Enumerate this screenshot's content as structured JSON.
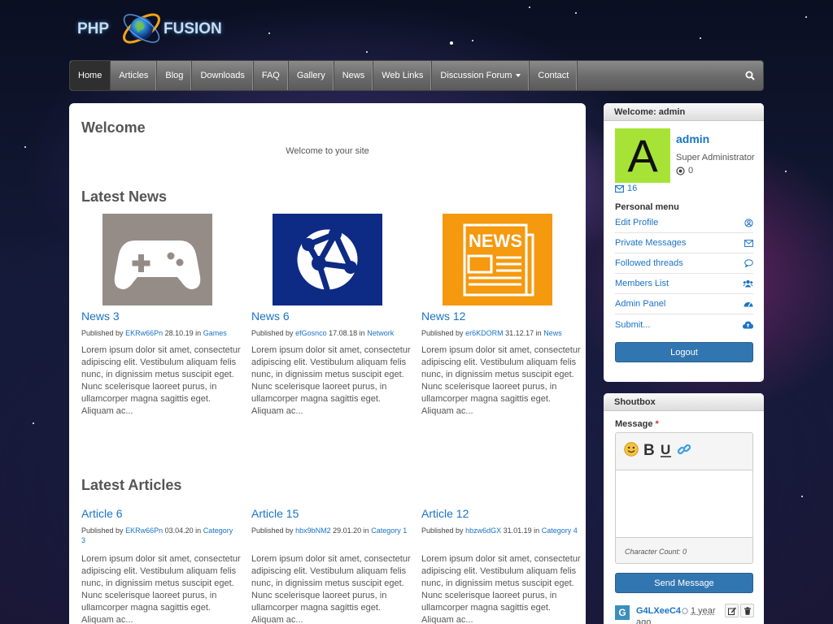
{
  "logo": {
    "left": "PHP",
    "right": "FUSION"
  },
  "nav": {
    "items": [
      {
        "label": "Home",
        "active": true
      },
      {
        "label": "Articles"
      },
      {
        "label": "Blog"
      },
      {
        "label": "Downloads"
      },
      {
        "label": "FAQ"
      },
      {
        "label": "Gallery"
      },
      {
        "label": "News"
      },
      {
        "label": "Web Links"
      },
      {
        "label": "Discussion Forum",
        "dropdown": true
      },
      {
        "label": "Contact"
      }
    ],
    "search_icon": "search-icon"
  },
  "main": {
    "welcome_title": "Welcome",
    "welcome_text": "Welcome to your site",
    "latest_news_title": "Latest News",
    "news": [
      {
        "title": "News 3",
        "published_by": "Published by",
        "author": "EKRw66Pn",
        "date": "28.10.19",
        "in": "in",
        "category": "Games",
        "icon": "gamepad-icon",
        "thumb_color": "#958c88",
        "excerpt": "Lorem ipsum dolor sit amet, consectetur adipiscing elit. Vestibulum aliquam felis nunc, in dignissim metus suscipit eget. Nunc scelerisque laoreet purus, in ullamcorper magna sagittis eget. Aliquam ac..."
      },
      {
        "title": "News 6",
        "published_by": "Published by",
        "author": "efGosnco",
        "date": "17.08.18",
        "in": "in",
        "category": "Network",
        "icon": "globe-network-icon",
        "thumb_color": "#0d2a84",
        "excerpt": "Lorem ipsum dolor sit amet, consectetur adipiscing elit. Vestibulum aliquam felis nunc, in dignissim metus suscipit eget. Nunc scelerisque laoreet purus, in ullamcorper magna sagittis eget. Aliquam ac..."
      },
      {
        "title": "News 12",
        "published_by": "Published by",
        "author": "er6KDORM",
        "date": "31.12.17",
        "in": "in",
        "category": "News",
        "icon": "newspaper-icon",
        "thumb_color": "#f5990f",
        "excerpt": "Lorem ipsum dolor sit amet, consectetur adipiscing elit. Vestibulum aliquam felis nunc, in dignissim metus suscipit eget. Nunc scelerisque laoreet purus, in ullamcorper magna sagittis eget. Aliquam ac..."
      }
    ],
    "newspaper_word": "NEWS",
    "latest_articles_title": "Latest Articles",
    "articles": [
      {
        "title": "Article 6",
        "published_by": "Published by",
        "author": "EKRw66Pn",
        "date": "03.04.20",
        "in": "in",
        "category": "Category 3",
        "excerpt": "Lorem ipsum dolor sit amet, consectetur adipiscing elit. Vestibulum aliquam felis nunc, in dignissim metus suscipit eget. Nunc scelerisque laoreet purus, in ullamcorper magna sagittis eget. Aliquam ac..."
      },
      {
        "title": "Article 15",
        "published_by": "Published by",
        "author": "hbx9bNM2",
        "date": "29.01.20",
        "in": "in",
        "category": "Category 1",
        "excerpt": "Lorem ipsum dolor sit amet, consectetur adipiscing elit. Vestibulum aliquam felis nunc, in dignissim metus suscipit eget. Nunc scelerisque laoreet purus, in ullamcorper magna sagittis eget. Aliquam ac..."
      },
      {
        "title": "Article 12",
        "published_by": "Published by",
        "author": "hbzw6dGX",
        "date": "31.01.19",
        "in": "in",
        "category": "Category 4",
        "excerpt": "Lorem ipsum dolor sit amet, consectetur adipiscing elit. Vestibulum aliquam felis nunc, in dignissim metus suscipit eget. Nunc scelerisque laoreet purus, in ullamcorper magna sagittis eget. Aliquam ac..."
      }
    ]
  },
  "user_panel": {
    "heading": "Welcome: admin",
    "avatar_letter": "A",
    "avatar_color": "#a6e336",
    "username": "admin",
    "role": "Super Administrator",
    "points": "0",
    "messages": "16",
    "personal_menu_title": "Personal menu",
    "menu": [
      {
        "label": "Edit Profile",
        "icon": "user-circle-icon"
      },
      {
        "label": "Private Messages",
        "icon": "envelope-icon"
      },
      {
        "label": "Followed threads",
        "icon": "comment-icon"
      },
      {
        "label": "Members List",
        "icon": "users-icon"
      },
      {
        "label": "Admin Panel",
        "icon": "dashboard-icon"
      },
      {
        "label": "Submit...",
        "icon": "cloud-upload-icon"
      }
    ],
    "logout_label": "Logout"
  },
  "shoutbox": {
    "heading": "Shoutbox",
    "message_label": "Message",
    "required_mark": "*",
    "char_count": "Character Count: 0",
    "send_label": "Send Message",
    "shout": {
      "avatar_letter": "G",
      "user": "G4LXeeC4",
      "time": "1 year",
      "ago": "ago"
    }
  },
  "colors": {
    "link": "#1a73c7",
    "button": "#3276b1",
    "avatar": "#a6e336"
  }
}
